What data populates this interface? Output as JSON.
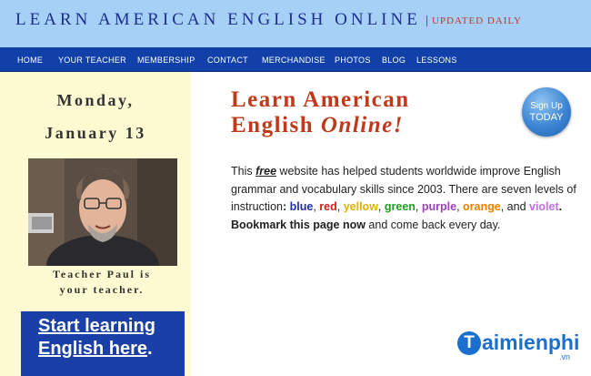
{
  "header": {
    "site_title": "LEARN AMERICAN ENGLISH ONLINE",
    "tagline": "UPDATED DAILY"
  },
  "nav": [
    {
      "label": "HOME"
    },
    {
      "label": "YOUR TEACHER"
    },
    {
      "label": "MEMBERSHIP"
    },
    {
      "label": "CONTACT"
    },
    {
      "label": "MERCHANDISE"
    },
    {
      "label": "PHOTOS"
    },
    {
      "label": "BLOG"
    },
    {
      "label": "LESSONS"
    }
  ],
  "sidebar": {
    "day": "Monday,",
    "date": "January 13",
    "caption_line1": "Teacher Paul is",
    "caption_line2": "your teacher.",
    "cta_link": "Start learning English here",
    "cta_period": "."
  },
  "main": {
    "title_line1": "Learn American",
    "title_line2_plain": "English ",
    "title_line2_italic": "Online!",
    "signup_line1": "Sign Up",
    "signup_line2": "TODAY",
    "intro": {
      "p1": "This ",
      "free": "free",
      "p2": " website has helped students worldwide improve English grammar and vocabulary skills since 2003. There are seven levels of instruction",
      "colon": ":",
      "blue": "blue",
      "comma1": ", ",
      "red": "red",
      "comma2": ",  ",
      "yellow": "yellow",
      "comma3": ",  ",
      "green": "green",
      "comma4": ",  ",
      "purple": "purple",
      "comma5": ", ",
      "orange": "orange",
      "and": ", and ",
      "violet": "violet",
      "period": ". ",
      "bookmark": "Bookmark this page now",
      "end": " and come back every day."
    }
  },
  "watermark": {
    "letter": "T",
    "text": "aimienphi",
    "suffix": ".vn"
  },
  "colors": {
    "header_bg": "#a6d0f6",
    "nav_bg": "#1040a8",
    "sidebar_bg": "#fefbd3",
    "title_red": "#c0391b",
    "cta_bg": "#1a3fa6"
  },
  "icons": {
    "signup": "sign-up-badge",
    "photo": "teacher-photo"
  }
}
